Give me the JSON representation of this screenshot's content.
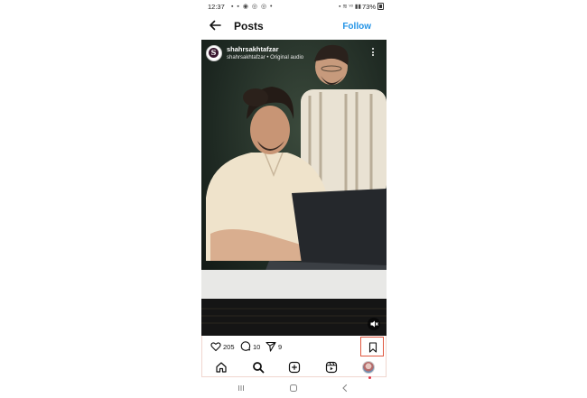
{
  "status_bar": {
    "time": "12:37",
    "notification_icons": "▪ ▪ ◉ ◎ ◎ •",
    "system_icons": "▪ ≋ ᵛᵒ ▮▮",
    "battery": "73%"
  },
  "header": {
    "title": "Posts",
    "follow_label": "Follow"
  },
  "post": {
    "username": "shahrsakhtafzar",
    "audio": "shahrsakhtafzar • Original audio",
    "avatar_letter": "S",
    "likes": "205",
    "comments": "10",
    "shares": "9"
  },
  "icons": {
    "back": "arrow-left",
    "more": "vertical-ellipsis",
    "mute": "speaker-muted",
    "like": "heart-outline",
    "comment": "speech-bubble",
    "share": "paper-plane",
    "save": "bookmark-outline",
    "nav": [
      "home",
      "search",
      "create",
      "reels",
      "profile"
    ],
    "system": [
      "recent-apps",
      "home",
      "back"
    ]
  },
  "colors": {
    "follow": "#2494e6",
    "highlight": "#e0573f",
    "notification_dot": "#e0384a"
  }
}
